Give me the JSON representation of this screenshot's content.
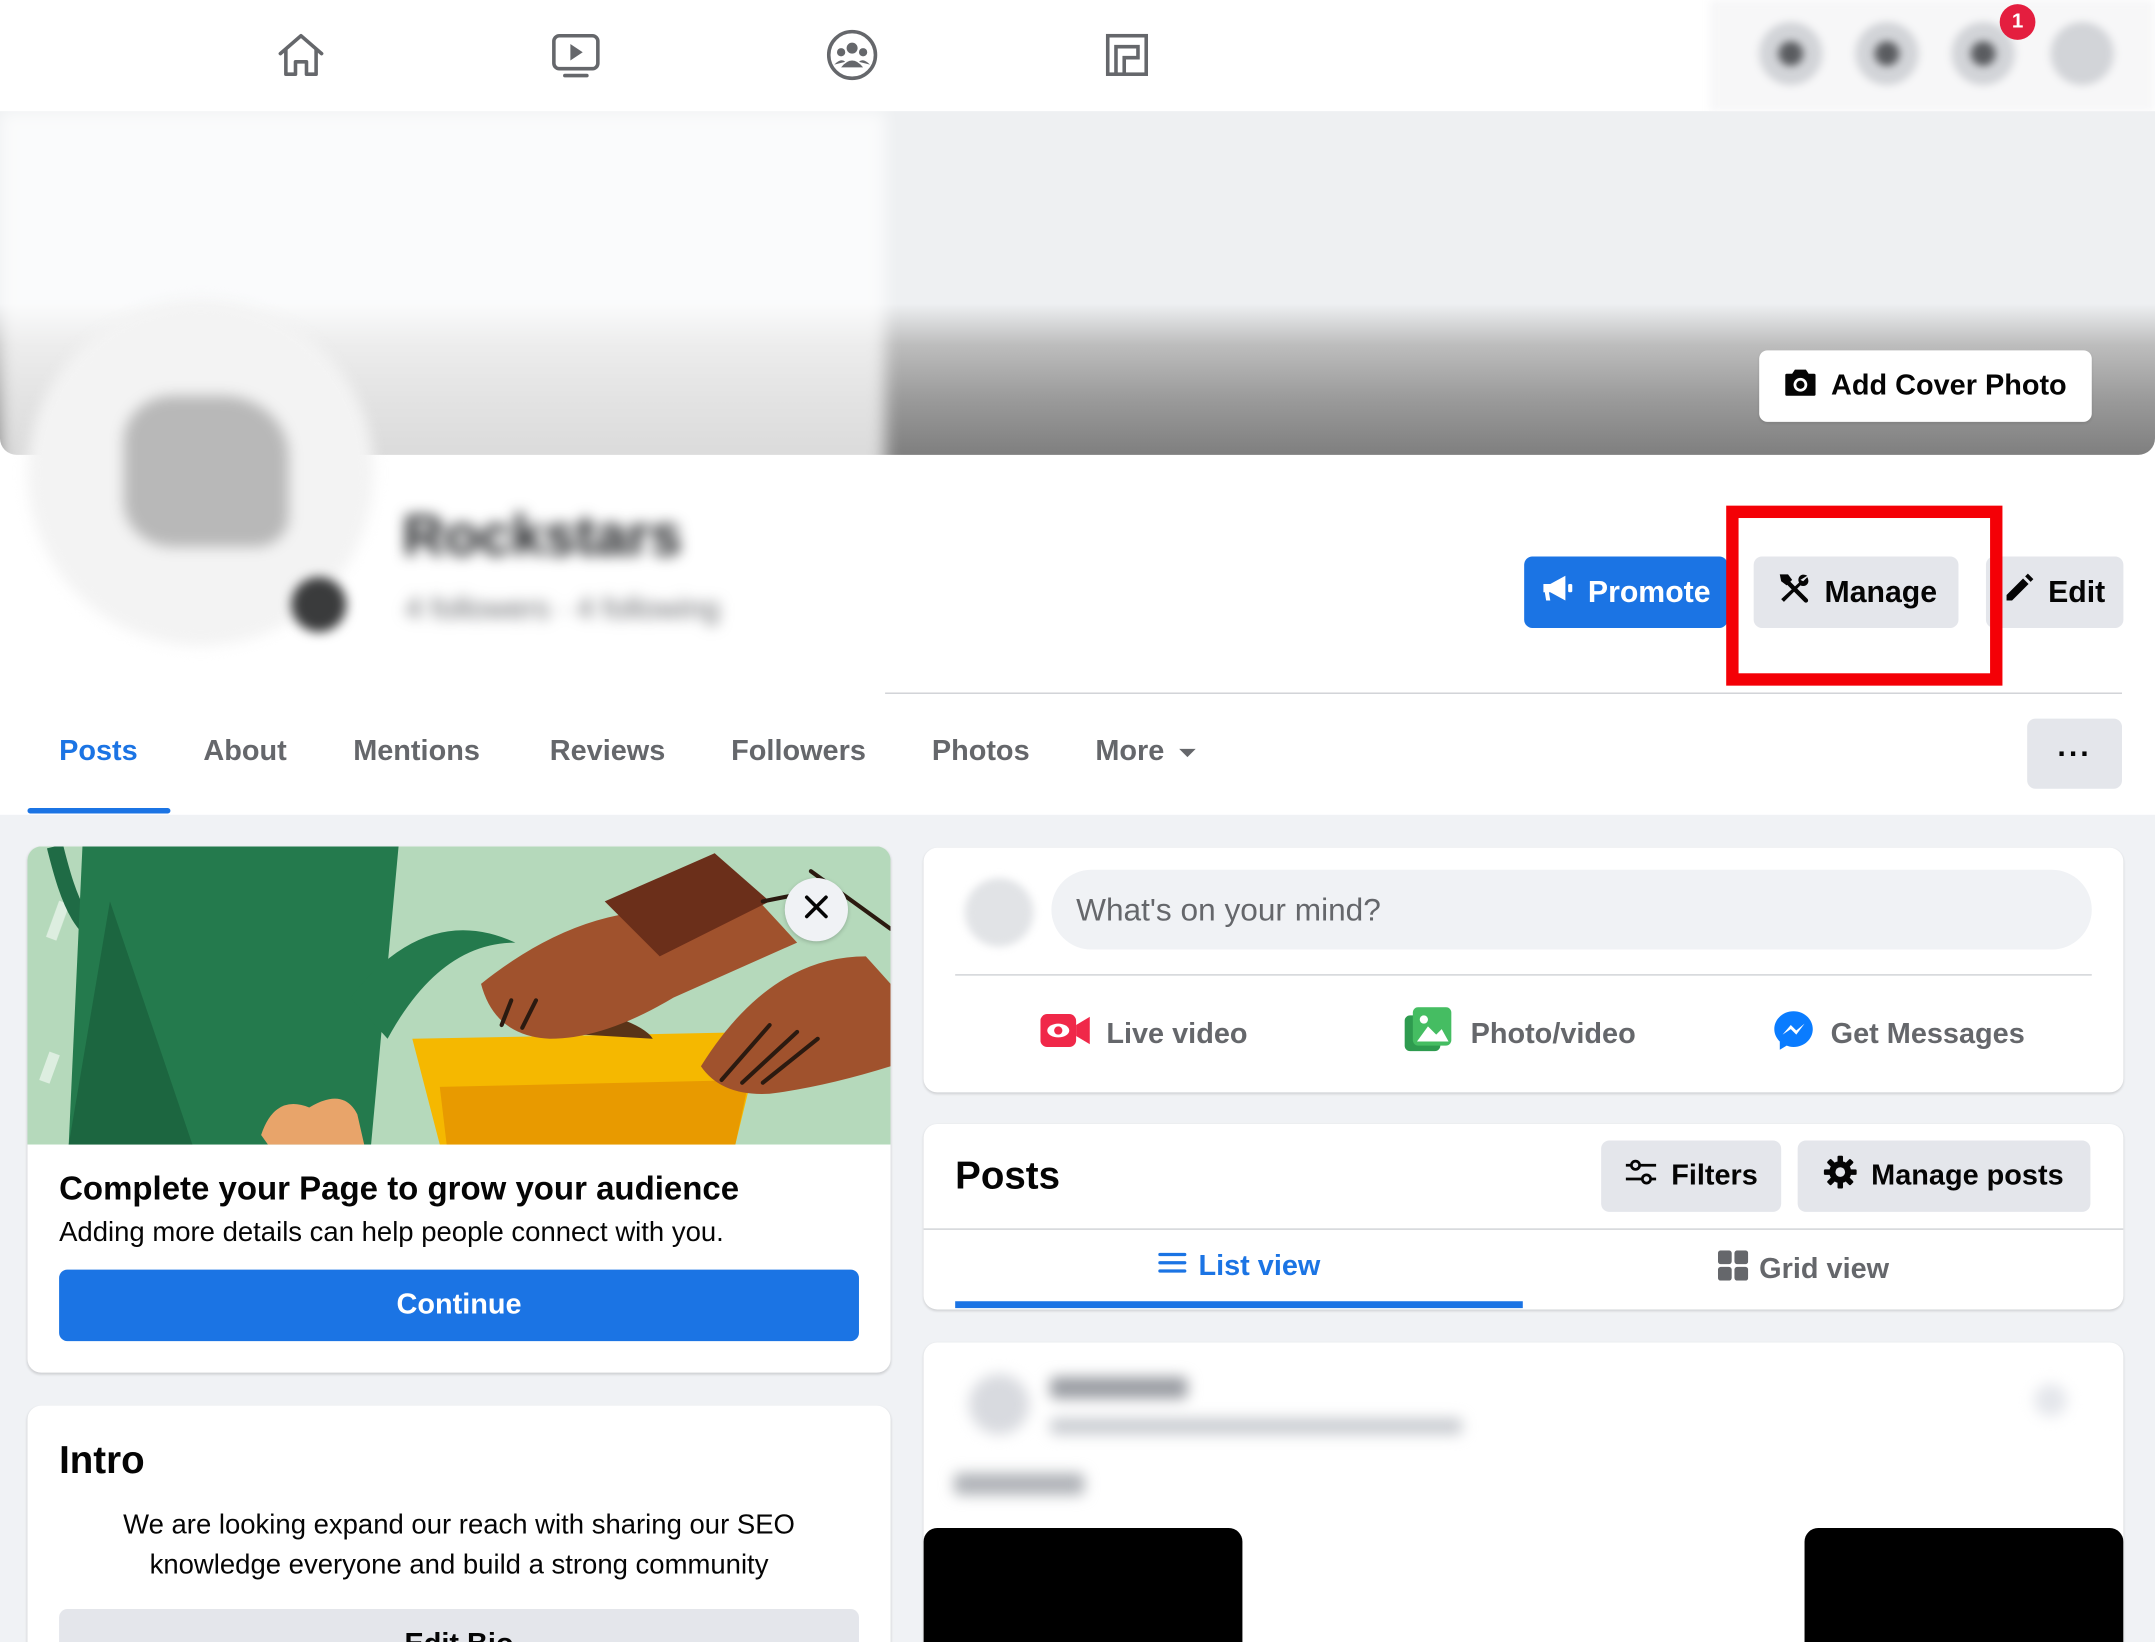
{
  "header": {
    "notification_count": "1",
    "add_cover_label": "Add Cover Photo",
    "page_name": "Rockstars",
    "page_stats": "4 followers · 4 following"
  },
  "actions": {
    "promote_label": "Promote",
    "manage_label": "Manage",
    "edit_label": "Edit",
    "more_label": "···"
  },
  "tabs": [
    {
      "label": "Posts",
      "active": true
    },
    {
      "label": "About"
    },
    {
      "label": "Mentions"
    },
    {
      "label": "Reviews"
    },
    {
      "label": "Followers"
    },
    {
      "label": "Photos"
    },
    {
      "label": "More"
    }
  ],
  "grow_card": {
    "title": "Complete your Page to grow your audience",
    "subtitle": "Adding more details can help people connect with you.",
    "continue_label": "Continue"
  },
  "intro": {
    "title": "Intro",
    "text": "We are looking expand our reach with sharing our SEO knowledge everyone and build a strong community",
    "edit_bio_label": "Edit Bio"
  },
  "composer": {
    "placeholder": "What's on your mind?",
    "live_label": "Live video",
    "photo_label": "Photo/video",
    "messages_label": "Get Messages"
  },
  "posts": {
    "title": "Posts",
    "filters_label": "Filters",
    "manage_posts_label": "Manage posts",
    "list_view_label": "List view",
    "grid_view_label": "Grid view"
  },
  "colors": {
    "brand_blue": "#1b74e4",
    "highlight_red": "#f40006",
    "live_red": "#f02849",
    "photo_green": "#45bd62",
    "messenger_blue": "#0a7cff"
  }
}
